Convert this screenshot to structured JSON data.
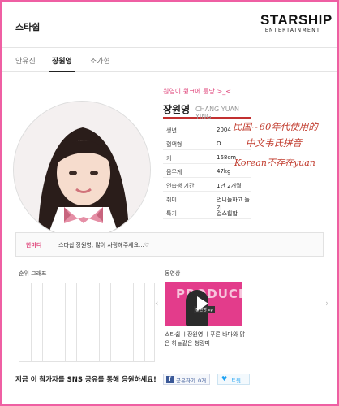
{
  "header": {
    "agency_title": "스타쉽",
    "logo_text": "STARSHIP",
    "logo_subtext": "ENTERTAINMENT"
  },
  "tabs": [
    {
      "label": "안유진",
      "active": false
    },
    {
      "label": "장원영",
      "active": true
    },
    {
      "label": "조가현",
      "active": false
    }
  ],
  "profile": {
    "tagline": "원영이 윙크에 튠당 >_<",
    "name": "장원영",
    "romanized_name": "CHANG YUAN YING",
    "fields": [
      {
        "key": "생년",
        "value": "2004"
      },
      {
        "key": "혈액형",
        "value": "O"
      },
      {
        "key": "키",
        "value": "168cm"
      },
      {
        "key": "몸무게",
        "value": "47kg"
      },
      {
        "key": "연습생 기간",
        "value": "1년 2개월"
      },
      {
        "key": "취미",
        "value": "언니들하고 놀기"
      },
      {
        "key": "특기",
        "value": "걸스힙합"
      }
    ]
  },
  "annotations": {
    "line1": "民国~60年代使用的",
    "line2": "中文韦氏拼音",
    "line3": "Korean不存在yuan"
  },
  "comment": {
    "label": "한마디",
    "text": "스타쉽 장원영, 많이 사랑해주세요...♡"
  },
  "sections": {
    "rank_graph_title": "순위 그래프",
    "video_title": "동영상"
  },
  "video": {
    "thumb_title": "PRODUCE",
    "thumb_caption": "장원영 ep",
    "caption": "스타쉽 ㅣ장원영 ㅣ푸른 바다와 맑은 하늘같은 청량미"
  },
  "bottom": {
    "cta": "지금 이 참가자를 SNS 공유를 통해 응원하세요!",
    "facebook_label": "공유하기",
    "facebook_count": "0개",
    "twitter_label": "트윗"
  },
  "colors": {
    "page_border": "#ef5fa3",
    "accent_pink": "#e0487d",
    "annotation_red": "#c0392b",
    "facebook": "#3b5998",
    "twitter": "#1da1f2"
  },
  "icons": [
    "star-icon",
    "play-icon",
    "chevron-left-icon",
    "chevron-right-icon",
    "facebook-icon",
    "twitter-icon"
  ]
}
